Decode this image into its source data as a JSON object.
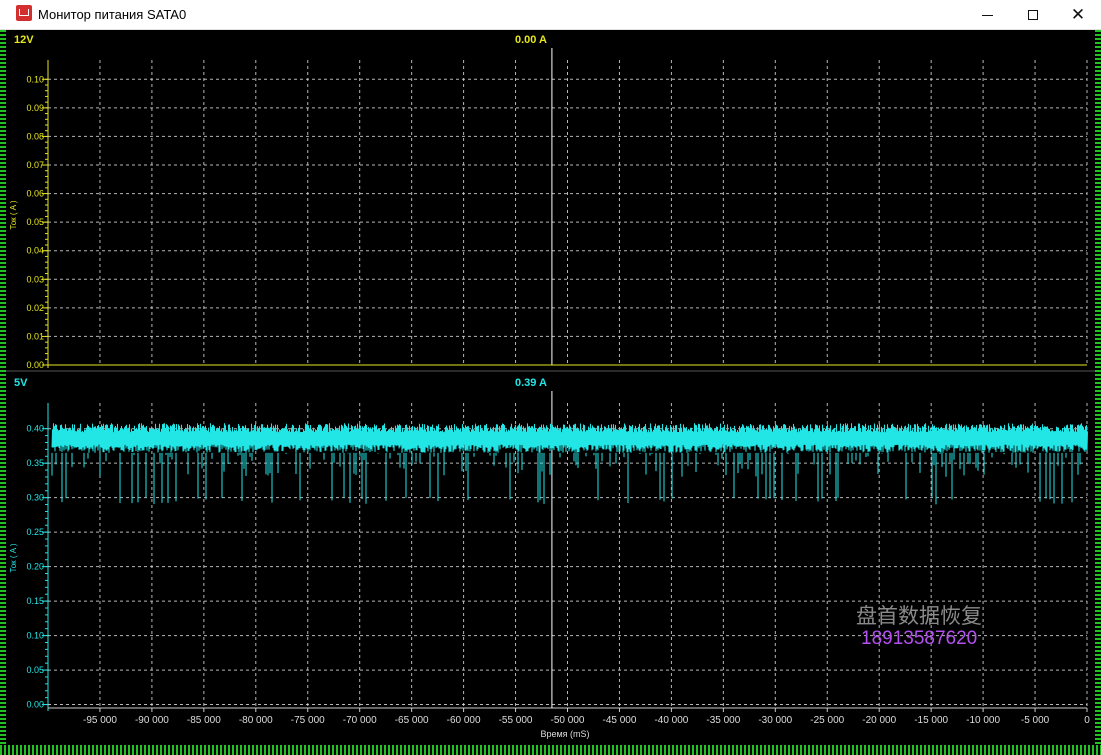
{
  "window": {
    "title": "Монитор питания SATA0",
    "icon": "app-icon",
    "buttons": [
      "minimize-icon",
      "maximize-icon",
      "close-icon"
    ]
  },
  "colors": {
    "background": "#000000",
    "panel_12v": "#e6e61e",
    "panel_5v": "#22e6e6",
    "grid": "#d8d8d8",
    "cursor": "#ffffff",
    "frame": "#22c222"
  },
  "watermark": {
    "text": "盘首数据恢复",
    "phone": "18913587620"
  },
  "chart_data": [
    {
      "type": "line",
      "rail": "12V",
      "readout": "0.00 A",
      "ylabel": "Ток ( A )",
      "ylim": [
        0,
        0.105
      ],
      "yticks": [
        "0.10",
        "0.09",
        "0.08",
        "0.07",
        "0.06",
        "0.05",
        "0.04",
        "0.03",
        "0.02",
        "0.01",
        "0.00"
      ],
      "ytick_values": [
        0.1,
        0.09,
        0.08,
        0.07,
        0.06,
        0.05,
        0.04,
        0.03,
        0.02,
        0.01,
        0.0
      ],
      "xlim": [
        -100000,
        0
      ],
      "cursor_x": -51500,
      "grid": true,
      "series": [
        {
          "values": [
            0.0,
            0.0
          ]
        }
      ]
    },
    {
      "type": "line",
      "rail": "5V",
      "readout": "0.39 A",
      "ylabel": "Ток ( A )",
      "xlabel": "Время (mS)",
      "ylim": [
        -0.005,
        0.43
      ],
      "yticks": [
        "0.40",
        "0.35",
        "0.30",
        "0.25",
        "0.20",
        "0.15",
        "0.10",
        "0.05",
        "0.00"
      ],
      "ytick_values": [
        0.4,
        0.35,
        0.3,
        0.25,
        0.2,
        0.15,
        0.1,
        0.05,
        0.0
      ],
      "xlim": [
        -100000,
        0
      ],
      "xticks": [
        "-95 000",
        "-90 000",
        "-85 000",
        "-80 000",
        "-75 000",
        "-70 000",
        "-65 000",
        "-60 000",
        "-55 000",
        "-50 000",
        "-45 000",
        "-40 000",
        "-35 000",
        "-30 000",
        "-25 000",
        "-20 000",
        "-15 000",
        "-10 000",
        "-5 000",
        "0"
      ],
      "xtick_values": [
        -95000,
        -90000,
        -85000,
        -80000,
        -75000,
        -70000,
        -65000,
        -60000,
        -55000,
        -50000,
        -45000,
        -40000,
        -35000,
        -30000,
        -25000,
        -20000,
        -15000,
        -10000,
        -5000,
        0
      ],
      "cursor_x": -51500,
      "grid": true,
      "series": [
        {
          "baseline": 0.38,
          "band_low": 0.365,
          "band_high": 0.405,
          "dip_min": 0.29
        }
      ]
    }
  ]
}
